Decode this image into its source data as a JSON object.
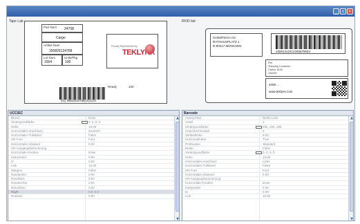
{
  "window": {
    "controls": {
      "minimize": "_",
      "maximize": "▫",
      "close": "×"
    }
  },
  "left_label_section": "Tape Lab",
  "right_label_section": "RFID lab",
  "left_label": {
    "fields": [
      {
        "key": "Part Num",
        "value": "24758"
      },
      {
        "key": "",
        "value": "Cargo"
      },
      {
        "key": "Artikel Nuer",
        "value": "150826124768"
      },
      {
        "key": "Lot Num",
        "value": "1004"
      },
      {
        "key": "Units/Pkg",
        "value": "100"
      }
    ],
    "logo_tagline": "Proudly Represented by",
    "logo_text": "TEKLYNX",
    "ready_label": "Ready",
    "ready_value": "100",
    "barcode_text": "(01) 56824524786(10)1234"
  },
  "right_label": {
    "address_lines": [
      "CHEMTECH AG",
      "RATHAUSPLATZ 1",
      "D-80217 MÜNCHEN"
    ],
    "barcode_text": "23061312412345678944",
    "box2_lines": [
      "Ref",
      "Shipping Container",
      "Carrier 8100",
      "100000"
    ],
    "box3_lines": [
      "4008 ...",
      "www.teklynx.com"
    ]
  },
  "left_grid": {
    "title": "UCC/EC",
    "rows": [
      {
        "k": "Breed",
        "v": "Enter"
      },
      {
        "k": "Hintergrundfarbe",
        "v": "0, 0, 0, 0",
        "swatch": true
      },
      {
        "k": "Höhe",
        "v": "19.00"
      },
      {
        "k": "Horizontaler Anschluss",
        "v": "Zentriert"
      },
      {
        "k": "Horizontaler Füllstand",
        "v": "False"
      },
      {
        "k": "HR Font",
        "v": "Font"
      },
      {
        "k": "Horizontaler Abstand",
        "v": "0.00"
      },
      {
        "k": "HR Ausgangsberechnung",
        "v": ""
      },
      {
        "k": "Horizontale Position",
        "v": "Enter"
      },
      {
        "k": "Interpreted",
        "v": "0.00"
      },
      {
        "k": "I2",
        "v": "0.00"
      },
      {
        "k": "Link",
        "v": "18.00"
      },
      {
        "k": "Margins",
        "v": "False"
      },
      {
        "k": "Randunten",
        "v": "0.00"
      },
      {
        "k": "Randlinks",
        "v": "0.00"
      },
      {
        "k": "Randrechts",
        "v": "0.00"
      },
      {
        "k": "Randoben",
        "v": "0.00"
      },
      {
        "k": "Right",
        "v": "0.0, 0.0",
        "selected": true
      },
      {
        "k": "Rotation",
        "v": "0.00"
      }
    ]
  },
  "right_grid": {
    "title": "Barcode",
    "rows": [
      {
        "k": "Autosymbol",
        "v": "Direkt Linie"
      },
      {
        "k": "Anteil",
        "v": "1"
      },
      {
        "k": "Hintergrundfarbe",
        "v": "255, 255, 255",
        "swatch": true
      },
      {
        "k": "Unterstrichmodus",
        "v": "0"
      },
      {
        "k": "Vertikalhöhe",
        "v": "8.00"
      },
      {
        "k": "Horizontalhöhe",
        "v": "True"
      },
      {
        "k": "Prüfmodus",
        "v": "Standard"
      },
      {
        "k": "Breite",
        "v": "False"
      },
      {
        "k": "Vordergrundfarbe",
        "v": "0, 0, 0, 0",
        "swatch": true
      },
      {
        "k": "Höhe",
        "v": "15.00"
      },
      {
        "k": "Horizontaler Anschluss",
        "v": "Links"
      },
      {
        "k": "Horizontaler Füllstand",
        "v": "False"
      },
      {
        "k": "HR Font",
        "v": "Font"
      },
      {
        "k": "Horizontaler Abstand",
        "v": "0.00"
      },
      {
        "k": "HR Ausgangsberechnung",
        "v": ""
      },
      {
        "k": "Horizontale Position",
        "v": "Enter"
      },
      {
        "k": "Interpreted",
        "v": "0.00"
      },
      {
        "k": "I2",
        "v": "0.00"
      },
      {
        "k": "Link",
        "v": "18.00"
      }
    ]
  }
}
